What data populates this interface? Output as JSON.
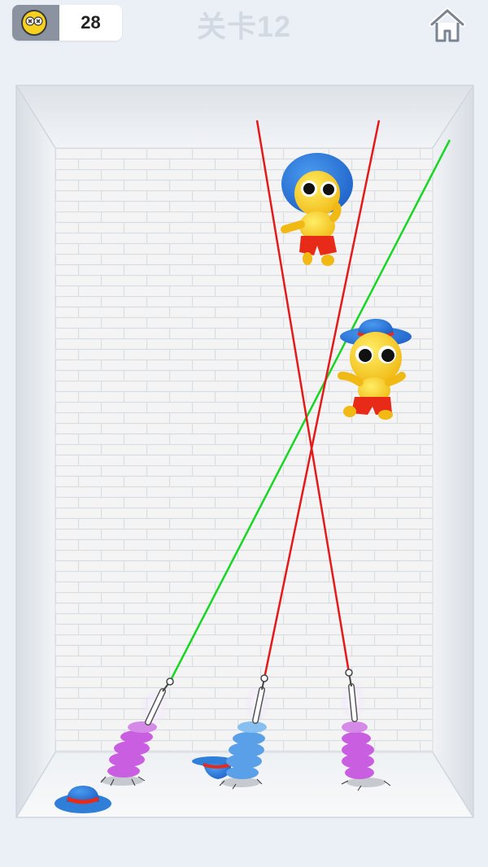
{
  "hud": {
    "counter_value": "28",
    "counter_icon": "dead-face-icon",
    "level_title": "关卡12",
    "home_icon": "home-icon"
  },
  "colors": {
    "red_laser": "#e51919",
    "green_laser": "#18d624",
    "character_body": "#f6d21f",
    "hat_blue": "#2f7ed8",
    "shorts_red": "#e82a18",
    "spring_purple": "#c95ee0",
    "spring_blue": "#5aa0e8"
  }
}
